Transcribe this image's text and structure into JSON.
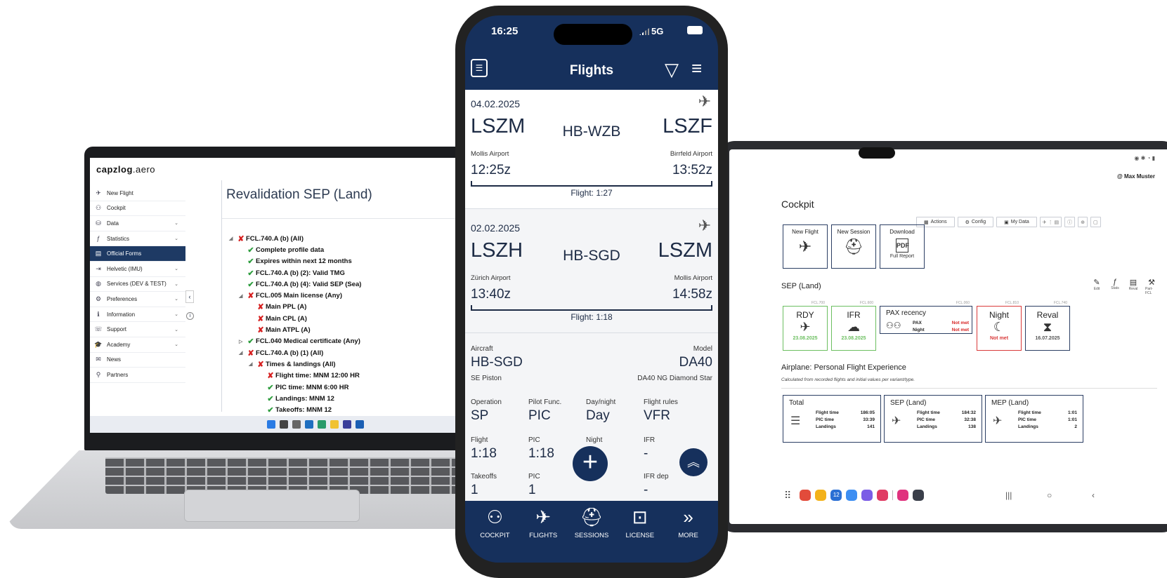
{
  "laptop": {
    "brand": "capzlog",
    "brand_tld": ".aero",
    "sidebar": [
      {
        "icon": "✈",
        "label": "New Flight",
        "chevron": false
      },
      {
        "icon": "⚇",
        "label": "Cockpit",
        "chevron": false
      },
      {
        "icon": "⛁",
        "label": "Data",
        "chevron": true
      },
      {
        "icon": "ƒ",
        "label": "Statistics",
        "chevron": true
      },
      {
        "icon": "▤",
        "label": "Official Forms",
        "chevron": false,
        "active": true
      },
      {
        "icon": "⇥",
        "label": "Helvetic (IMU)",
        "chevron": true
      },
      {
        "icon": "◍",
        "label": "Services (DEV & TEST)",
        "chevron": true
      },
      {
        "icon": "⚙",
        "label": "Preferences",
        "chevron": true
      },
      {
        "icon": "ℹ",
        "label": "Information",
        "chevron": true
      },
      {
        "icon": "☏",
        "label": "Support",
        "chevron": true
      },
      {
        "icon": "🎓",
        "label": "Academy",
        "chevron": true
      },
      {
        "icon": "✉",
        "label": "News",
        "chevron": false
      },
      {
        "icon": "⚲",
        "label": "Partners",
        "chevron": false
      }
    ],
    "page_title": "Revalidation SEP (Land)",
    "tree": [
      {
        "level": 0,
        "expander": "◢",
        "status": "x",
        "label": "FCL.740.A (b) (All)"
      },
      {
        "level": 1,
        "expander": "",
        "status": "ok",
        "label": "Complete profile data"
      },
      {
        "level": 1,
        "expander": "",
        "status": "ok",
        "label": "Expires within next 12 months"
      },
      {
        "level": 1,
        "expander": "",
        "status": "ok",
        "label": "FCL.740.A (b) (2): Valid TMG"
      },
      {
        "level": 1,
        "expander": "",
        "status": "ok",
        "label": "FCL.740.A (b) (4): Valid SEP (Sea)"
      },
      {
        "level": 1,
        "expander": "◢",
        "status": "x",
        "label": "FCL.005 Main license (Any)"
      },
      {
        "level": 2,
        "expander": "",
        "status": "x",
        "label": "Main PPL (A)"
      },
      {
        "level": 2,
        "expander": "",
        "status": "x",
        "label": "Main CPL (A)"
      },
      {
        "level": 2,
        "expander": "",
        "status": "x",
        "label": "Main ATPL (A)"
      },
      {
        "level": 1,
        "expander": "▷",
        "status": "ok",
        "label": "FCL.040 Medical certificate (Any)"
      },
      {
        "level": 1,
        "expander": "◢",
        "status": "x",
        "label": "FCL.740.A (b) (1) (All)"
      },
      {
        "level": 2,
        "expander": "◢",
        "status": "x",
        "label": "Times & landings (All)"
      },
      {
        "level": 3,
        "expander": "",
        "status": "x",
        "label": "Flight time: MNM 12:00 HR"
      },
      {
        "level": 3,
        "expander": "",
        "status": "ok",
        "label": "PIC time: MNM 6:00 HR"
      },
      {
        "level": 3,
        "expander": "",
        "status": "ok",
        "label": "Landings: MNM 12"
      },
      {
        "level": 3,
        "expander": "",
        "status": "ok",
        "label": "Takeoffs: MNM 12"
      }
    ],
    "collapse_glyph": "‹",
    "info_glyph": "i"
  },
  "phone": {
    "status_time": "16:25",
    "network": "5G",
    "title": "Flights",
    "flights": [
      {
        "date": "04.02.2025",
        "from": "LSZM",
        "to": "LSZF",
        "registration": "HB-WZB",
        "from_name": "Mollis Airport",
        "to_name": "Birrfeld Airport",
        "dep": "12:25z",
        "arr": "13:52z",
        "duration": "Flight: 1:27"
      },
      {
        "date": "02.02.2025",
        "from": "LSZH",
        "to": "LSZM",
        "registration": "HB-SGD",
        "from_name": "Zürich Airport",
        "to_name": "Mollis Airport",
        "dep": "13:40z",
        "arr": "14:58z",
        "duration": "Flight: 1:18"
      }
    ],
    "detail": {
      "aircraft_label": "Aircraft",
      "aircraft": "HB-SGD",
      "aircraft_class": "SE Piston",
      "model_label": "Model",
      "model": "DA40",
      "model_full": "DA40 NG Diamond Star",
      "row1": [
        {
          "label": "Operation",
          "value": "SP"
        },
        {
          "label": "Pilot Func.",
          "value": "PIC"
        },
        {
          "label": "Day/night",
          "value": "Day"
        },
        {
          "label": "Flight rules",
          "value": "VFR"
        }
      ],
      "row2": [
        {
          "label": "Flight",
          "value": "1:18"
        },
        {
          "label": "PIC",
          "value": "1:18"
        },
        {
          "label": "Night",
          "value": "-"
        },
        {
          "label": "IFR",
          "value": "-"
        }
      ],
      "row3": [
        {
          "label": "Takeoffs",
          "value": "1"
        },
        {
          "label": "PIC",
          "value": "1"
        },
        {
          "label": "IFR dep",
          "value": "-"
        }
      ]
    },
    "fab_add": "+",
    "fab_top": "︽",
    "tabs": [
      {
        "icon": "⚇",
        "label": "COCKPIT"
      },
      {
        "icon": "✈",
        "label": "FLIGHTS"
      },
      {
        "icon": "⛑",
        "label": "SESSIONS"
      },
      {
        "icon": "⊡",
        "label": "LICENSE"
      },
      {
        "icon": "»",
        "label": "MORE"
      }
    ]
  },
  "tablet": {
    "user": "Max Muster",
    "title": "Cockpit",
    "toolbar": [
      {
        "icon": "▦",
        "label": "Actions"
      },
      {
        "icon": "⚙",
        "label": "Config"
      },
      {
        "icon": "▣",
        "label": "My Data"
      }
    ],
    "quick_tiles": [
      {
        "title": "New Flight",
        "icon": "✈",
        "caption": ""
      },
      {
        "title": "New Session",
        "icon": "⛑",
        "caption": ""
      },
      {
        "title": "Download",
        "icon": "PDF",
        "caption": "Full Report"
      }
    ],
    "sep_title": "SEP (Land)",
    "sep_tools": [
      {
        "icon": "✎",
        "label": "Edit"
      },
      {
        "icon": "ƒ",
        "label": "Stats"
      },
      {
        "icon": "▤",
        "label": "Reval"
      },
      {
        "icon": "⚒",
        "label": "Part-FCL"
      }
    ],
    "status_tiles": [
      {
        "title": "RDY",
        "tag": "FCL.700",
        "icon": "✈",
        "date": "23.08.2025",
        "state": "ok"
      },
      {
        "title": "IFR",
        "tag": "FCL.600",
        "icon": "☁",
        "date": "23.08.2025",
        "state": "ok"
      },
      {
        "title": "Night",
        "tag": "FCL.810",
        "icon": "☾",
        "date": "Not met",
        "state": "bad"
      },
      {
        "title": "Reval",
        "tag": "FCL.740",
        "icon": "⧗",
        "date": "16.07.2025",
        "state": "neutral"
      }
    ],
    "pax": {
      "title": "PAX recency",
      "tag": "FCL.060",
      "rows": [
        {
          "k": "PAX",
          "v": "Not met"
        },
        {
          "k": "Night",
          "v": "Not met"
        }
      ]
    },
    "exp_title": "Airplane: Personal Flight Experience",
    "exp_sub": "Calculated from recorded flights and initial values per variant/type.",
    "experience": [
      {
        "title": "Total",
        "icon": "☰",
        "rows": [
          {
            "k": "Flight time",
            "v": "186:05"
          },
          {
            "k": "PIC time",
            "v": "33:39"
          },
          {
            "k": "Landings",
            "v": "141"
          }
        ]
      },
      {
        "title": "SEP (Land)",
        "icon": "✈",
        "rows": [
          {
            "k": "Flight time",
            "v": "184:32"
          },
          {
            "k": "PIC time",
            "v": "32:38"
          },
          {
            "k": "Landings",
            "v": "138"
          }
        ]
      },
      {
        "title": "MEP (Land)",
        "icon": "✈",
        "rows": [
          {
            "k": "Flight time",
            "v": "1:01"
          },
          {
            "k": "PIC time",
            "v": "1:01"
          },
          {
            "k": "Landings",
            "v": "2"
          }
        ]
      }
    ],
    "dock_colors": [
      "#e24b3b",
      "#f3b21a",
      "#2a6fd4",
      "#3d8ef2",
      "#7b5ce6",
      "#e03b63",
      "#e0327e",
      "#3a3f4a"
    ],
    "dock_calendar_text": "12"
  }
}
